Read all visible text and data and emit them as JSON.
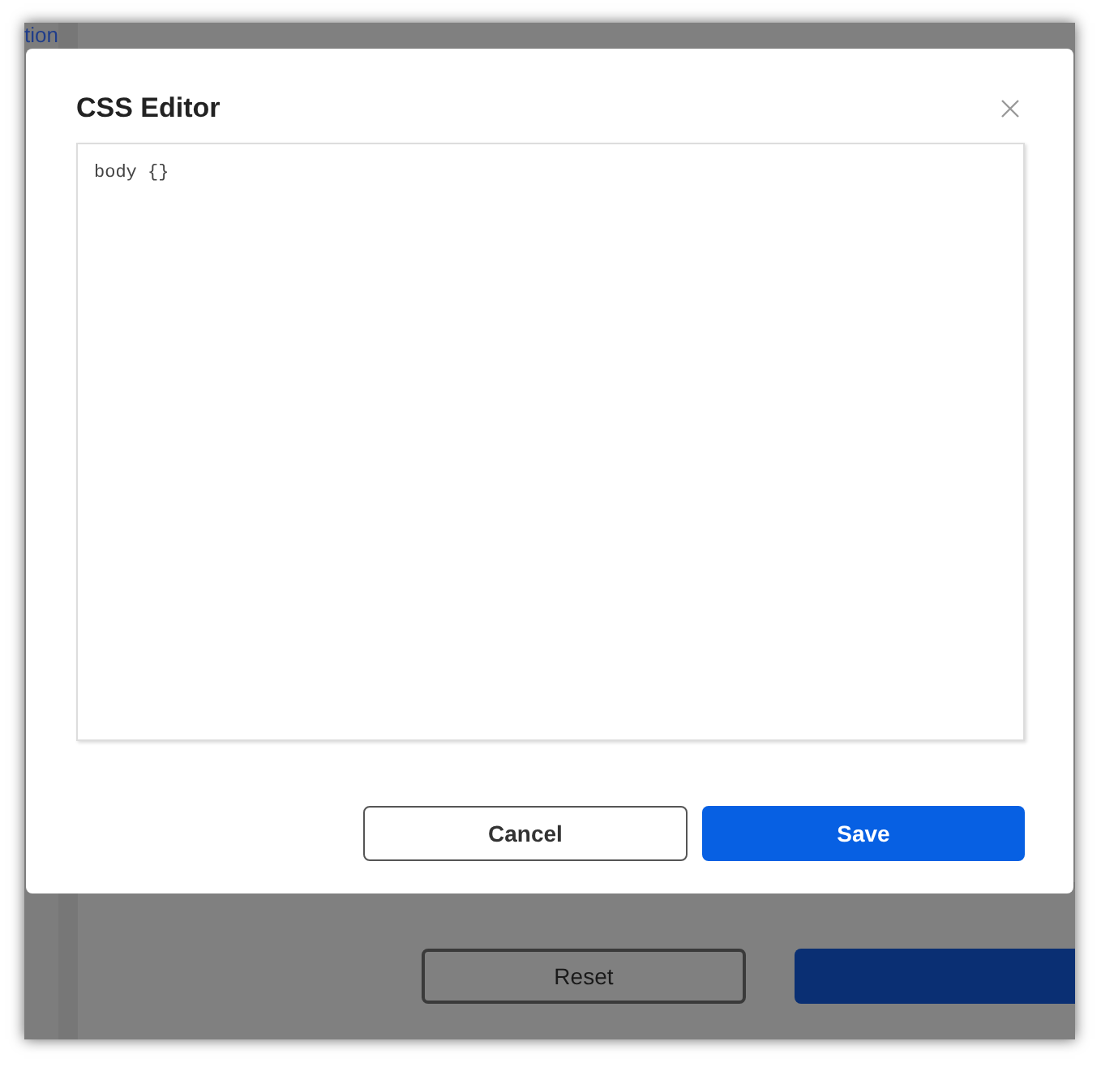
{
  "background_page": {
    "link_text": "tion",
    "buttons": [
      {
        "label": "Reset",
        "kind": "secondary"
      },
      {
        "kind": "primary"
      }
    ]
  },
  "dialog": {
    "title": "CSS Editor",
    "editor_value": "body {}",
    "buttons": [
      {
        "label": "Cancel",
        "kind": "secondary"
      },
      {
        "label": "Save",
        "kind": "primary"
      }
    ]
  }
}
